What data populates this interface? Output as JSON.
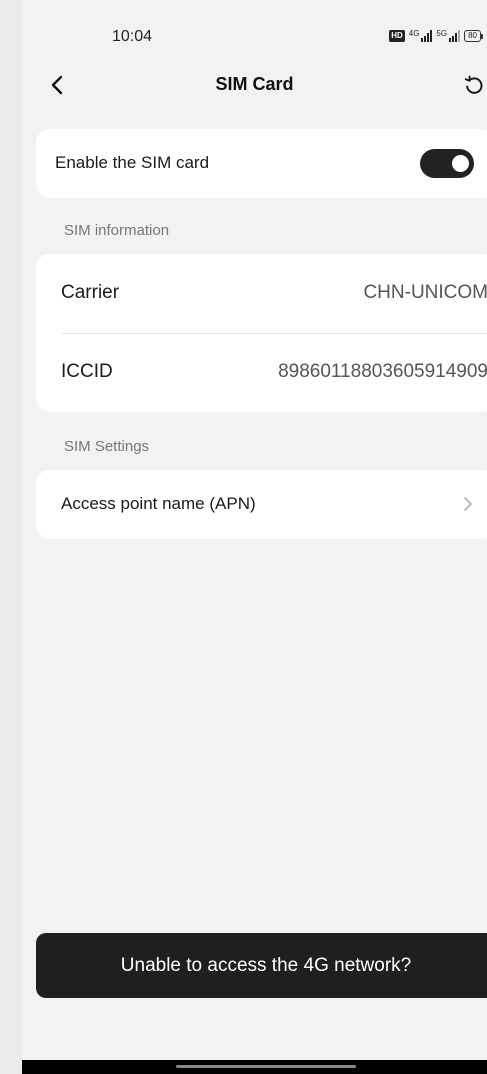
{
  "status_bar": {
    "time": "10:04",
    "hd": "HD",
    "net1": "4G",
    "net2": "5G",
    "battery": "80"
  },
  "nav": {
    "title": "SIM Card"
  },
  "enable_card": {
    "label": "Enable the SIM card",
    "enabled": true
  },
  "sim_info": {
    "header": "SIM information",
    "rows": [
      {
        "label": "Carrier",
        "value": "CHN-UNICOM"
      },
      {
        "label": "ICCID",
        "value": "89860118803605914909"
      }
    ]
  },
  "sim_settings": {
    "header": "SIM Settings",
    "apn_label": "Access point name (APN)"
  },
  "bottom_button": {
    "label": "Unable to access the 4G network?"
  },
  "colors": {
    "background": "#f2f2f2",
    "card": "#ffffff",
    "toggle_on": "#222222",
    "button": "#1f1f1f"
  }
}
